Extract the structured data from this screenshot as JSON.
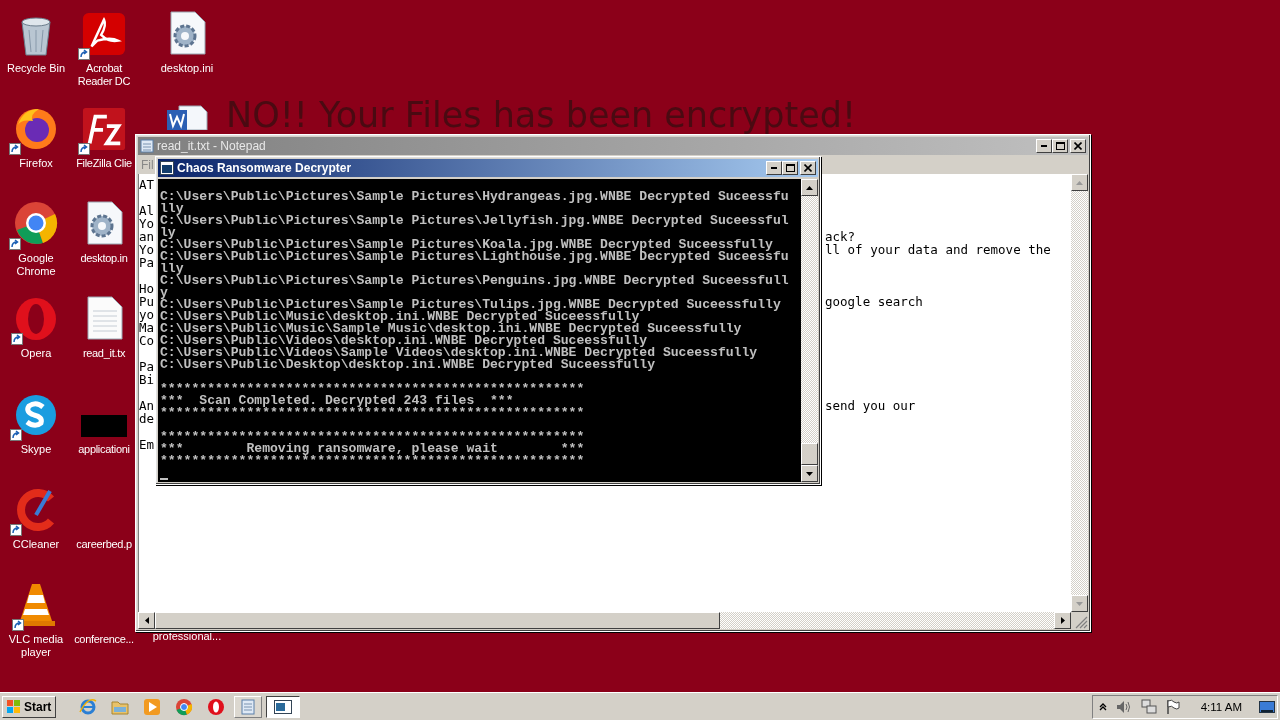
{
  "desktop": {
    "wallpaper_text": "NO!! Your Files has been encrypted!",
    "columns": [
      [
        {
          "label": "Recycle Bin",
          "kind": "recycle"
        },
        {
          "label": "Firefox",
          "kind": "firefox",
          "shortcut": true
        },
        {
          "label": "Google Chrome",
          "kind": "chrome",
          "shortcut": true
        },
        {
          "label": "Opera",
          "kind": "opera",
          "shortcut": true
        },
        {
          "label": "Skype",
          "kind": "skype",
          "shortcut": true
        },
        {
          "label": "CCleaner",
          "kind": "ccleaner",
          "shortcut": true
        },
        {
          "label": "VLC media player",
          "kind": "vlc",
          "shortcut": true
        }
      ],
      [
        {
          "label": "Acrobat Reader DC",
          "kind": "acrobat",
          "shortcut": true
        },
        {
          "label": "FileZilla Clie",
          "kind": "filezilla",
          "shortcut": true
        },
        {
          "label": "desktop.in",
          "kind": "settings-file"
        },
        {
          "label": "read_it.tx",
          "kind": "text-file"
        },
        {
          "label": "applicationi",
          "kind": "hidden-file"
        },
        {
          "label": "careerbed.p",
          "kind": "blank"
        },
        {
          "label": "conference...",
          "kind": "blank"
        }
      ],
      [
        {
          "label": "desktop.ini",
          "kind": "settings-file"
        },
        {
          "kind": "word"
        },
        {
          "label": "professional...",
          "kind": "blank"
        }
      ]
    ]
  },
  "notepad": {
    "title": "read_it.txt - Notepad",
    "active": false,
    "menu": [
      "Fil"
    ],
    "paragraphs": [
      [
        {
          "start": "AT"
        }
      ],
      [
        {
          "start": "Al"
        },
        {
          "start": "Yo"
        },
        {
          "start": "an",
          "end": "ack?"
        },
        {
          "start": "Yo",
          "end": "ll of your data and remove the"
        },
        {
          "start": "Pa"
        }
      ],
      [
        {
          "start": "Ho"
        },
        {
          "start": "Pu",
          "end": "google search"
        },
        {
          "start": "yo"
        },
        {
          "start": "Ma"
        },
        {
          "start": "Co"
        }
      ],
      [
        {
          "start": "Pa"
        },
        {
          "start": "Bi"
        }
      ],
      [
        {
          "start": "An",
          "end": "send you our"
        },
        {
          "start": "de"
        }
      ],
      [
        {
          "start": "Em"
        }
      ]
    ]
  },
  "console": {
    "title": "Chaos Ransomware Decrypter",
    "active": true,
    "blocks": [
      [
        "C:\\Users\\Public\\Pictures\\Sample Pictures\\Hydrangeas.jpg.WNBE Decrypted Suceessfu",
        "lly",
        "C:\\Users\\Public\\Pictures\\Sample Pictures\\Jellyfish.jpg.WNBE Decrypted Suceessful",
        "ly",
        "C:\\Users\\Public\\Pictures\\Sample Pictures\\Koala.jpg.WNBE Decrypted Suceessfully",
        "C:\\Users\\Public\\Pictures\\Sample Pictures\\Lighthouse.jpg.WNBE Decrypted Suceessfu",
        "lly",
        "C:\\Users\\Public\\Pictures\\Sample Pictures\\Penguins.jpg.WNBE Decrypted Suceessfull",
        "y",
        "C:\\Users\\Public\\Pictures\\Sample Pictures\\Tulips.jpg.WNBE Decrypted Suceessfully",
        "C:\\Users\\Public\\Music\\desktop.ini.WNBE Decrypted Suceessfully",
        "C:\\Users\\Public\\Music\\Sample Music\\desktop.ini.WNBE Decrypted Suceessfully",
        "C:\\Users\\Public\\Videos\\desktop.ini.WNBE Decrypted Suceessfully",
        "C:\\Users\\Public\\Videos\\Sample Videos\\desktop.ini.WNBE Decrypted Suceessfully",
        "C:\\Users\\Public\\Desktop\\desktop.ini.WNBE Decrypted Suceessfully"
      ],
      [
        "******************************************************",
        "***  Scan Completed. Decrypted 243 files  ***",
        "******************************************************"
      ],
      [
        "******************************************************",
        "***        Removing ransomware, please wait        ***",
        "******************************************************"
      ]
    ]
  },
  "taskbar": {
    "start": "Start",
    "items": [
      {
        "kind": "ie",
        "selected": false
      },
      {
        "kind": "folder",
        "selected": false
      },
      {
        "kind": "media",
        "selected": false
      },
      {
        "kind": "chrome",
        "selected": false
      },
      {
        "kind": "opera",
        "selected": false
      },
      {
        "kind": "notepad",
        "selected": false
      },
      {
        "kind": "console",
        "selected": true
      }
    ],
    "clock": "4:11 AM"
  }
}
